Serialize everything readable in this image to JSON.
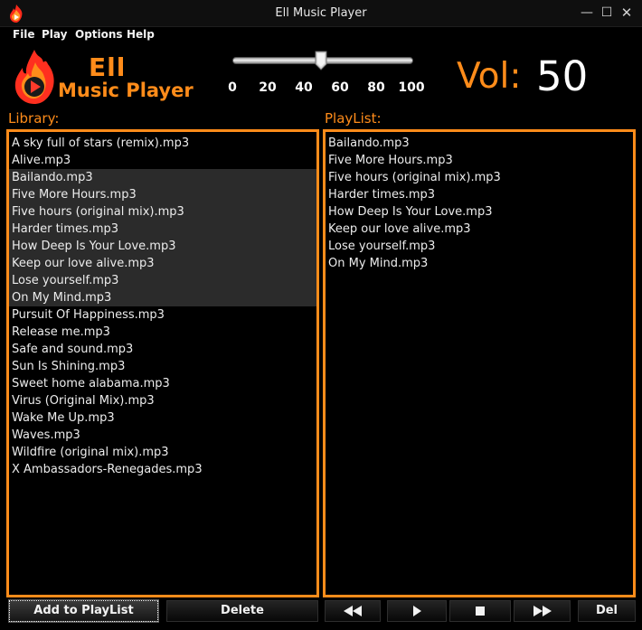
{
  "window": {
    "title": "Ell Music Player",
    "icon": "flame-play-icon",
    "controls": {
      "minimize": "—",
      "maximize": "☐",
      "close": "✕"
    }
  },
  "menu": {
    "file": "File",
    "play": "Play",
    "options": "Options",
    "help": "Help"
  },
  "logo": {
    "line1": "Ell",
    "line2": "Music Player",
    "icon": "flame-play-icon"
  },
  "volume": {
    "label": "Vol:",
    "value": "50",
    "slider_fraction": 0.5,
    "ticks": [
      "0",
      "20",
      "40",
      "60",
      "80",
      "100"
    ]
  },
  "library": {
    "label": "Library:",
    "items": [
      "A sky full of stars (remix).mp3",
      "Alive.mp3",
      "Bailando.mp3",
      "Five More Hours.mp3",
      "Five hours (original mix).mp3",
      "Harder times.mp3",
      "How Deep Is Your Love.mp3",
      "Keep our love alive.mp3",
      "Lose yourself.mp3",
      "On My Mind.mp3",
      "Pursuit Of Happiness.mp3",
      "Release me.mp3",
      "Safe and sound.mp3",
      "Sun Is Shining.mp3",
      "Sweet home alabama.mp3",
      "Virus (Original Mix).mp3",
      "Wake Me Up.mp3",
      "Waves.mp3",
      "Wildfire (original mix).mp3",
      "X Ambassadors-Renegades.mp3"
    ],
    "selected_items": [
      "Bailando.mp3",
      "Five More Hours.mp3",
      "Five hours (original mix).mp3",
      "Harder times.mp3",
      "How Deep Is Your Love.mp3",
      "Keep our love alive.mp3",
      "Lose yourself.mp3",
      "On My Mind.mp3"
    ]
  },
  "playlist": {
    "label": "PlayList:",
    "items": [
      "Bailando.mp3",
      "Five More Hours.mp3",
      "Five hours (original mix).mp3",
      "Harder times.mp3",
      "How Deep Is Your Love.mp3",
      "Keep our love alive.mp3",
      "Lose yourself.mp3",
      "On My Mind.mp3"
    ]
  },
  "buttons": {
    "add_to_playlist": "Add to PlayList",
    "delete": "Delete",
    "del": "Del",
    "previous_icon": "previous-icon",
    "play_icon": "play-icon",
    "stop_icon": "stop-icon",
    "next_icon": "next-icon"
  },
  "colors": {
    "accent": "#ff8c1a",
    "background": "#000000",
    "selection": "#2b2b2b"
  }
}
